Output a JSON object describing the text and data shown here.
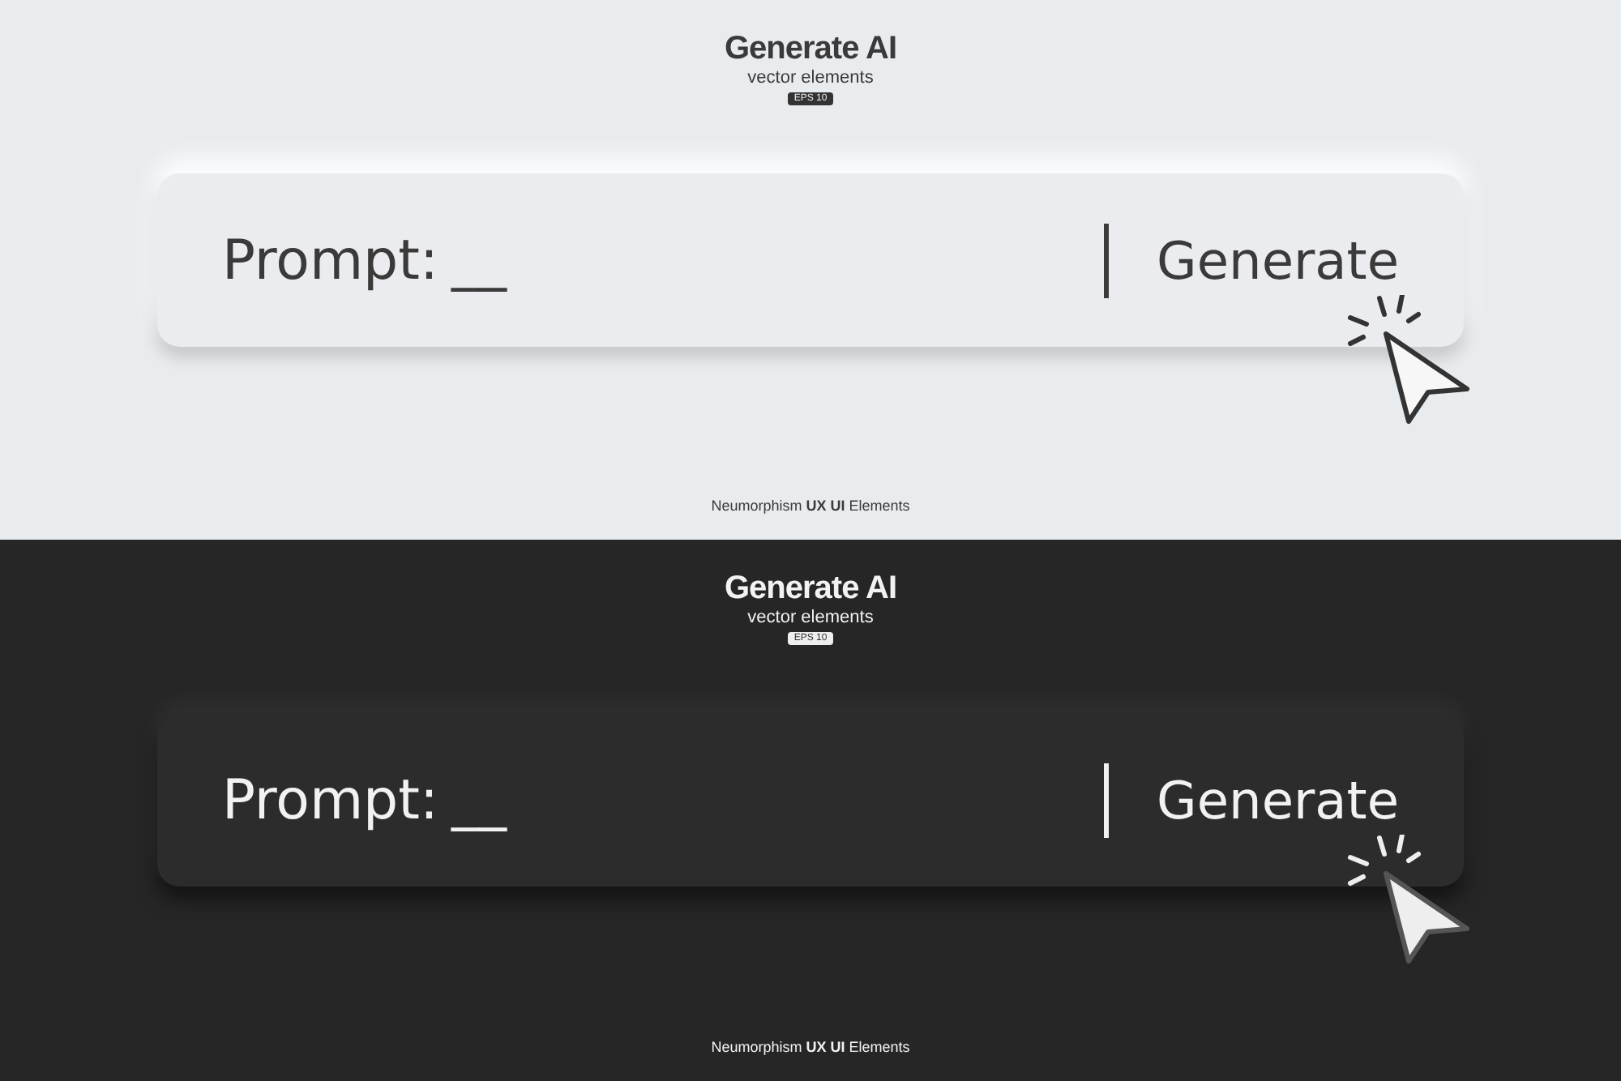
{
  "panels": [
    {
      "kind": "light",
      "title": "Generate AI",
      "subtitle": "vector elements",
      "badge": "EPS 10",
      "prompt_label": "Prompt:",
      "prompt_value": "__",
      "button": "Generate",
      "footer": "Neumorphism **UX UI** Elements"
    },
    {
      "kind": "dark",
      "title": "Generate AI",
      "subtitle": "vector elements",
      "badge": "EPS 10",
      "prompt_label": "Prompt:",
      "prompt_value": "__",
      "button": "Generate",
      "footer": "Neumorphism **UX UI** Elements"
    }
  ]
}
